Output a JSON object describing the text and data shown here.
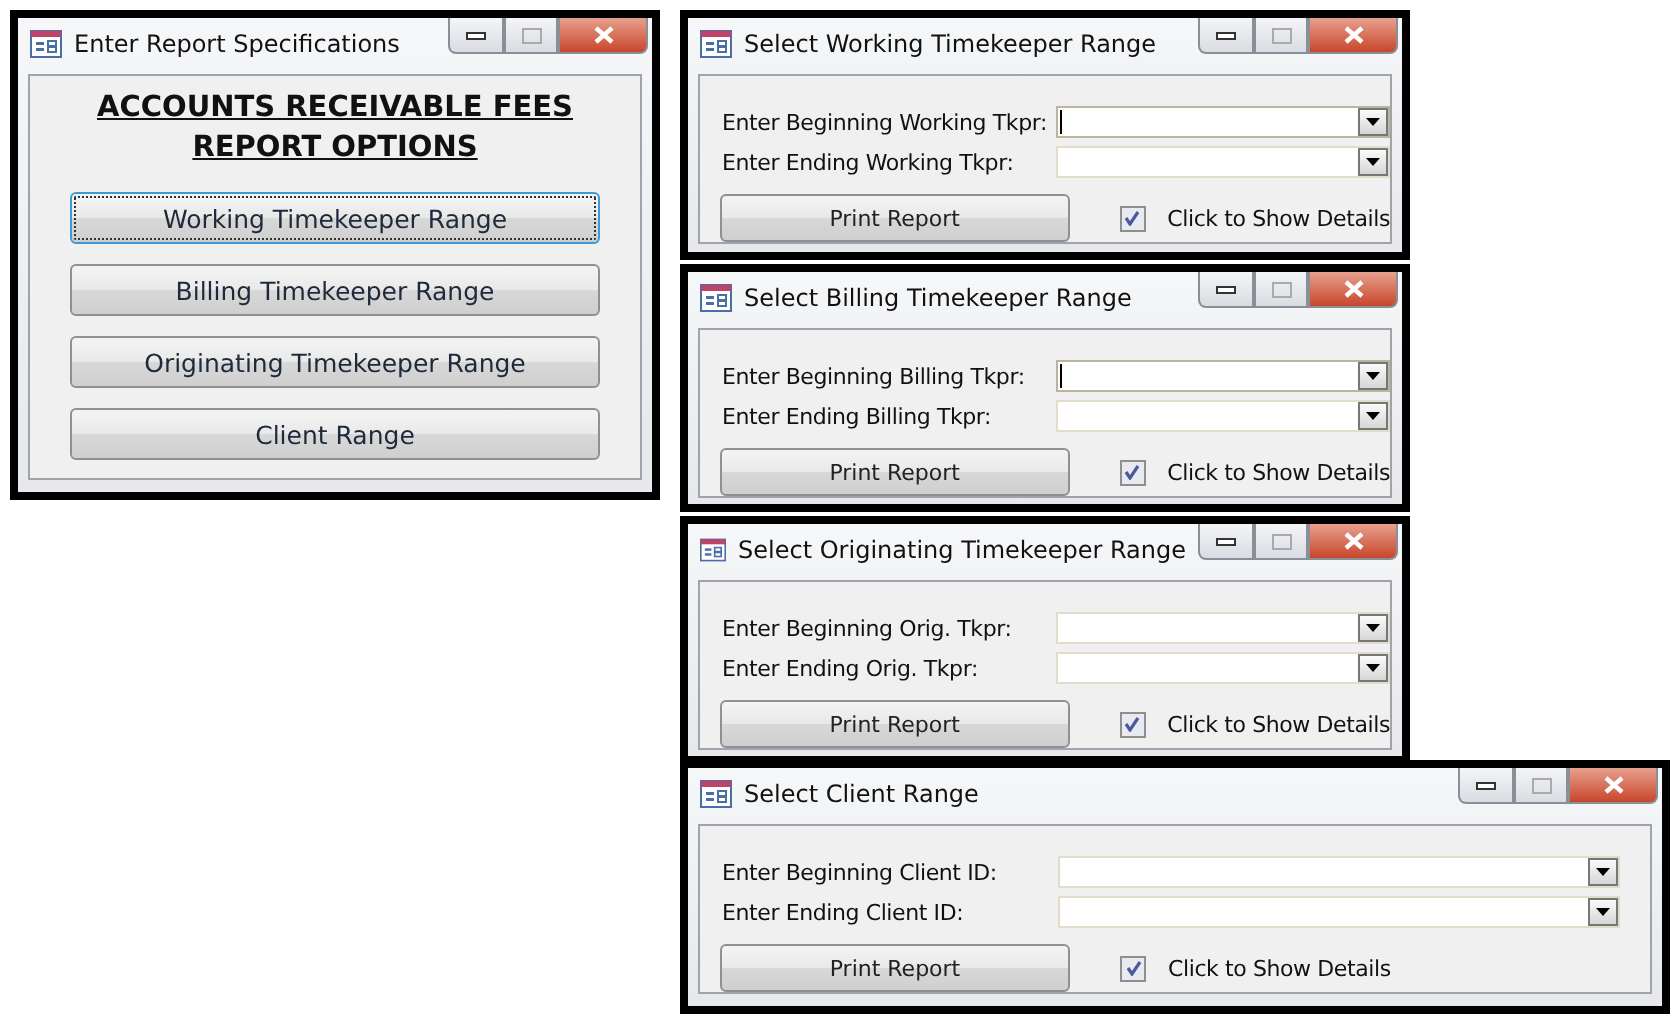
{
  "windows": [
    {
      "kind": "menu",
      "title": "Enter Report Specifications",
      "heading_lines": [
        "ACCOUNTS RECEIVABLE FEES",
        "REPORT OPTIONS"
      ],
      "buttons": [
        {
          "label": "Working Timekeeper Range",
          "focused": true
        },
        {
          "label": "Billing Timekeeper Range",
          "focused": false
        },
        {
          "label": "Originating Timekeeper Range",
          "focused": false
        },
        {
          "label": "Client Range",
          "focused": false
        }
      ]
    },
    {
      "kind": "range",
      "title": "Select Working Timekeeper Range",
      "fields": [
        {
          "label": "Enter Beginning Working Tkpr:",
          "focused": true
        },
        {
          "label": "Enter Ending Working Tkpr:",
          "focused": false
        }
      ],
      "print_button": "Print Report",
      "details": {
        "label": "Click to Show Details",
        "checked": true
      }
    },
    {
      "kind": "range",
      "title": "Select Billing Timekeeper Range",
      "fields": [
        {
          "label": "Enter Beginning Billing Tkpr:",
          "focused": true
        },
        {
          "label": "Enter Ending Billing Tkpr:",
          "focused": false
        }
      ],
      "print_button": "Print Report",
      "details": {
        "label": "Click to Show Details",
        "checked": true
      }
    },
    {
      "kind": "range",
      "title": "Select Originating Timekeeper Range",
      "fields": [
        {
          "label": "Enter Beginning Orig. Tkpr:",
          "focused": false
        },
        {
          "label": "Enter Ending Orig. Tkpr:",
          "focused": false
        }
      ],
      "print_button": "Print Report",
      "details": {
        "label": "Click to Show Details",
        "checked": true
      }
    },
    {
      "kind": "range",
      "title": "Select Client Range",
      "fields": [
        {
          "label": "Enter Beginning Client ID:",
          "focused": false
        },
        {
          "label": "Enter Ending Client ID:",
          "focused": false
        }
      ],
      "print_button": "Print Report",
      "details": {
        "label": "Click to Show Details",
        "checked": true
      }
    }
  ]
}
